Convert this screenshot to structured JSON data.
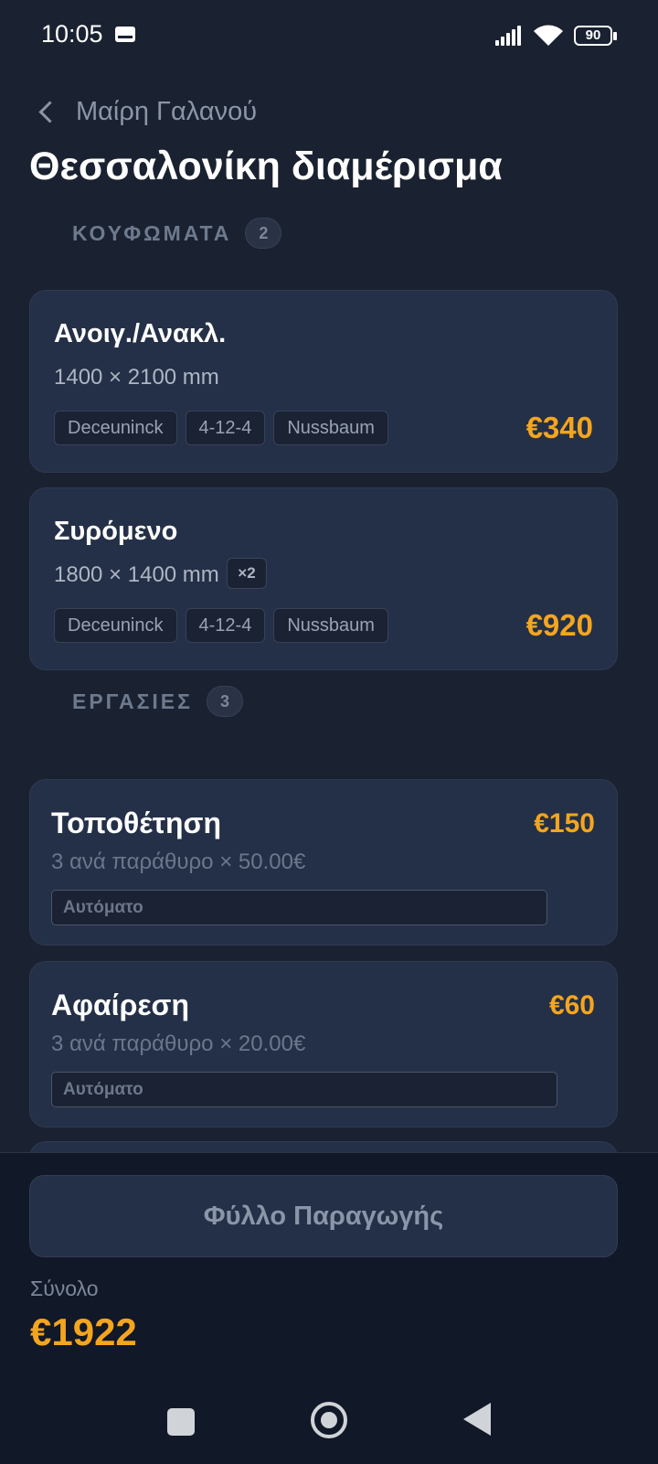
{
  "status_bar": {
    "time": "10:05",
    "battery": "90"
  },
  "header": {
    "back_label": "Μαίρη Γαλανού",
    "title": "Θεσσαλονίκη διαμέρισμα"
  },
  "sections": {
    "windows": {
      "label": "ΚΟΥΦΩΜΑΤΑ",
      "count": "2"
    },
    "jobs": {
      "label": "ΕΡΓΑΣΙΕΣ",
      "count": "3"
    }
  },
  "windows": [
    {
      "name": "Ανοιγ./Ανακλ.",
      "dimensions": "1400 × 2100 mm",
      "quantity": "",
      "tags": [
        "Deceuninck",
        "4-12-4",
        "Nussbaum"
      ],
      "price": "€340"
    },
    {
      "name": "Συρόμενο",
      "dimensions": "1800 × 1400 mm",
      "quantity": "×2",
      "tags": [
        "Deceuninck",
        "4-12-4",
        "Nussbaum"
      ],
      "price": "€920"
    }
  ],
  "jobs": [
    {
      "name": "Τοποθέτηση",
      "description": "3 ανά παράθυρο × 50.00€",
      "mode": "Αυτόματο",
      "price": "€150"
    },
    {
      "name": "Αφαίρεση",
      "description": "3 ανά παράθυρο × 20.00€",
      "mode": "Αυτόματο",
      "price": "€60"
    }
  ],
  "footer": {
    "production_button": "Φύλλο Παραγωγής",
    "total_label": "Σύνολο",
    "total_value": "€1922"
  },
  "colors": {
    "background": "#1a2130",
    "card": "#243047",
    "accent": "#f4a51f"
  },
  "icons": [
    "mail-icon",
    "signal-icon",
    "wifi-icon",
    "battery-icon",
    "back-chevron-icon",
    "nav-recents-icon",
    "nav-home-icon",
    "nav-back-icon"
  ]
}
